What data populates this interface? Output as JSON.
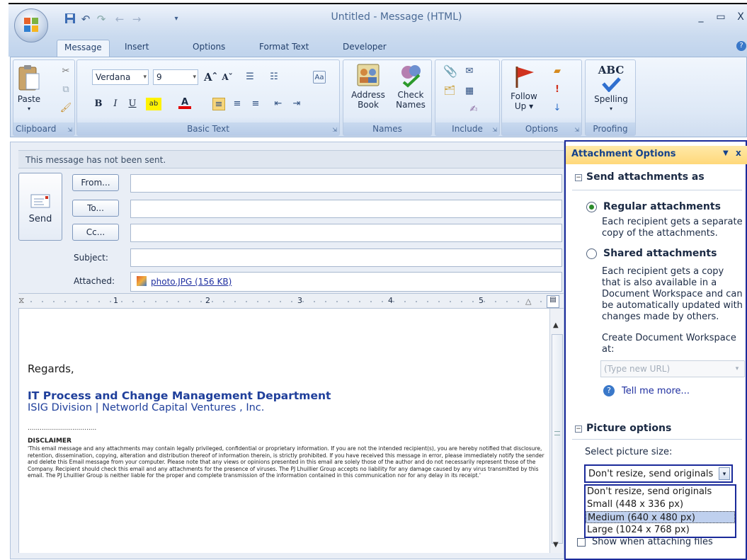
{
  "window": {
    "title": "Untitled - Message (HTML)",
    "minimize": "_",
    "maximize": "▭",
    "close": "X"
  },
  "quick_access": {
    "save": "💾",
    "undo": "↶",
    "redo": "↷",
    "prev": "←",
    "next": "→",
    "customize": "▾"
  },
  "tabs": [
    "Message",
    "Insert",
    "Options",
    "Format Text",
    "Developer"
  ],
  "ribbon": {
    "clipboard": {
      "label": "Clipboard",
      "paste": "Paste"
    },
    "basic_text": {
      "label": "Basic Text",
      "font": "Verdana",
      "size": "9",
      "bold": "B",
      "italic": "I",
      "underline": "U",
      "grow": "A",
      "shrink": "A",
      "font_color": "A"
    },
    "names": {
      "label": "Names",
      "address_book": "Address\nBook",
      "check_names": "Check\nNames"
    },
    "include": {
      "label": "Include"
    },
    "options": {
      "label": "Options",
      "follow_up": "Follow\nUp ▾"
    },
    "proofing": {
      "label": "Proofing",
      "spelling": "Spelling",
      "abc": "ABC"
    }
  },
  "compose": {
    "status": "This message has not been sent.",
    "send": "Send",
    "from": "From...",
    "to": "To...",
    "cc": "Cc...",
    "subject": "Subject:",
    "attached": "Attached:",
    "attachment": "photo.JPG (156 KB)",
    "ruler_marks": [
      "1",
      "2",
      "3",
      "4",
      "5"
    ]
  },
  "body": {
    "greeting": "Regards,",
    "department": "IT Process and Change Management Department",
    "division": "ISIG Division | Networld Capital Ventures , Inc.",
    "separator": "..................................",
    "disclaimer_title": "DISCLAIMER",
    "disclaimer": "'This email message and any attachments may contain legally privileged, confidential or proprietary information. If you are not the intended recipient(s), you are hereby notified that disclosure, retention, dissemination, copying, alteration and distribution thereof of information therein, is  strictly prohibited. If you have received this message in error, please immediately notify the sender and delete this Email message from your computer. Please note that any views or opinions presented in this email are solely those of the author and do not necessarily represent those of  the Company.  Recipient should check this email and any attachments for the presence of viruses.  The PJ Lhuillier Group accepts no liability for any damage caused by any virus transmitted by this email. The PJ Lhuillier Group is neither liable for the proper and complete transmission of the  information contained in this communication nor for any delay in its receipt.'"
  },
  "pane": {
    "title": "Attachment Options",
    "menu": "▼",
    "close": "x",
    "send_as": "Send attachments as",
    "regular": "Regular attachments",
    "regular_desc": "Each recipient gets a separate copy of the attachments.",
    "shared": "Shared attachments",
    "shared_desc": "Each recipient gets a copy that is also available in a Document Workspace and can be automatically updated with changes made by others.",
    "create_ws": "Create Document Workspace at:",
    "url_placeholder": "(Type new URL)",
    "tell_more": "Tell me more...",
    "picture_options": "Picture options",
    "select_size": "Select picture size:",
    "selected_size": "Don't resize, send originals",
    "sizes": [
      "Don't resize, send originals",
      "Small (448 x 336 px)",
      "Medium (640 x 480 px)",
      "Large (1024 x 768 px)"
    ],
    "show_when": "Show when attaching files"
  },
  "colors": {
    "accent": "#15428b",
    "pane_border": "#1a2a9a",
    "link": "#1f2fa0",
    "signature": "#1f3f9b"
  }
}
